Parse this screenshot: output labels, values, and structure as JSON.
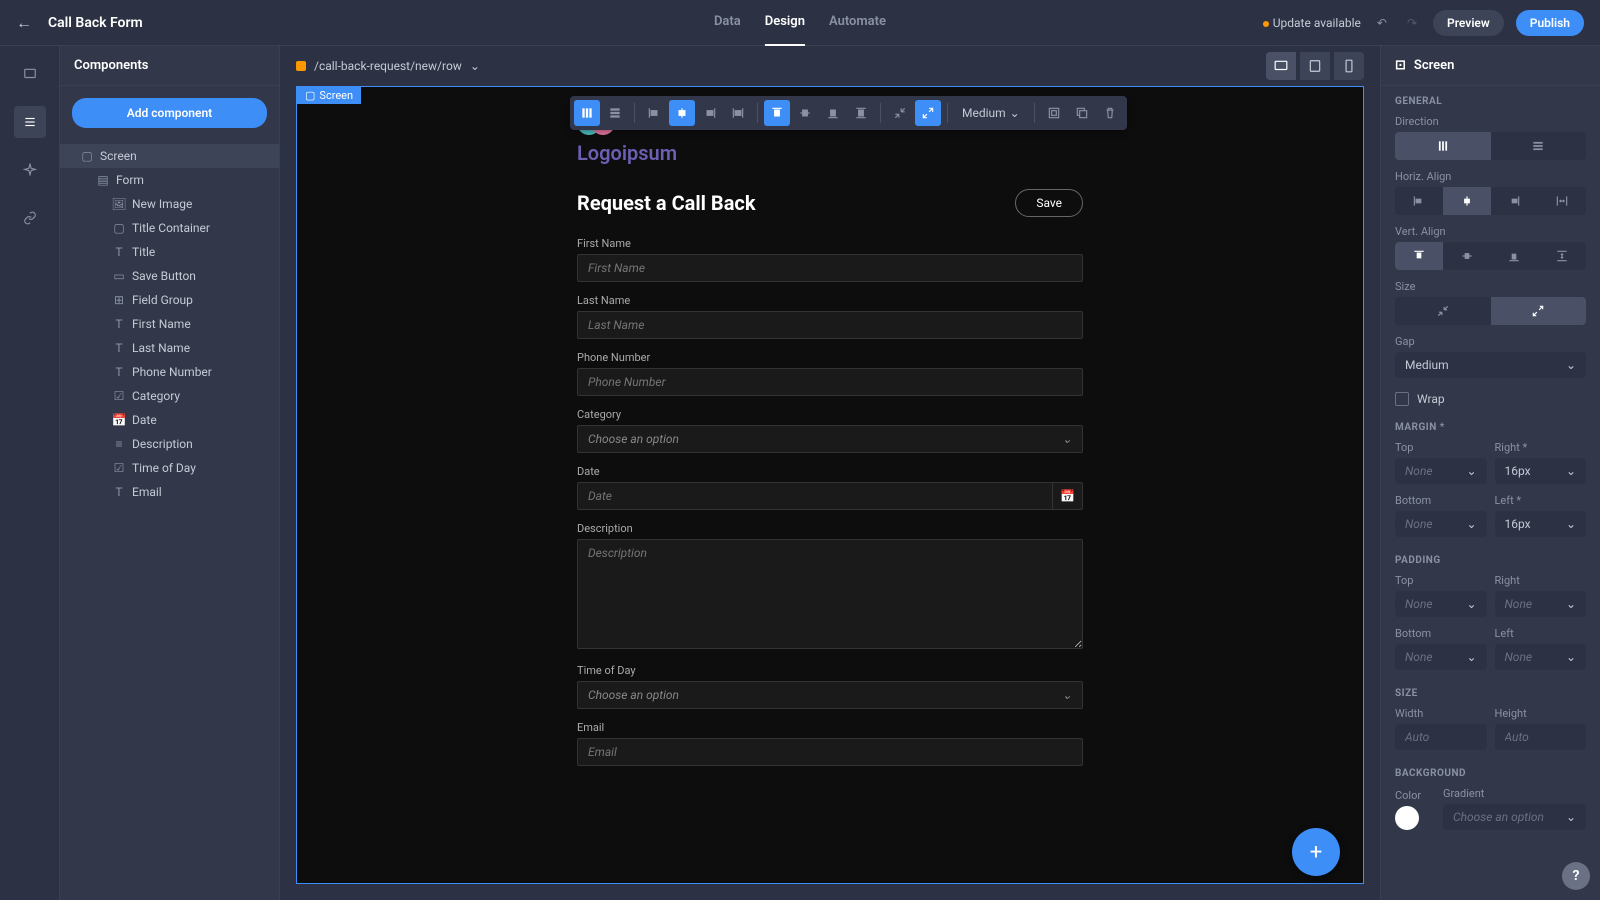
{
  "header": {
    "title": "Call Back Form",
    "tabs": {
      "data": "Data",
      "design": "Design",
      "automate": "Automate"
    },
    "update": "Update available",
    "preview": "Preview",
    "publish": "Publish"
  },
  "leftPanel": {
    "title": "Components",
    "addButton": "Add component",
    "tree": {
      "screen": "Screen",
      "form": "Form",
      "newImage": "New Image",
      "titleContainer": "Title Container",
      "title": "Title",
      "saveButton": "Save Button",
      "fieldGroup": "Field Group",
      "firstName": "First Name",
      "lastName": "Last Name",
      "phoneNumber": "Phone Number",
      "category": "Category",
      "date": "Date",
      "description": "Description",
      "timeOfDay": "Time of Day",
      "email": "Email"
    }
  },
  "breadcrumb": "/call-back-request/new/row",
  "screenTag": "Screen",
  "floatToolbar": {
    "gap": "Medium"
  },
  "form": {
    "logoText": "Logoipsum",
    "title": "Request a Call Back",
    "save": "Save",
    "firstName": {
      "label": "First Name",
      "placeholder": "First Name"
    },
    "lastName": {
      "label": "Last Name",
      "placeholder": "Last Name"
    },
    "phone": {
      "label": "Phone Number",
      "placeholder": "Phone Number"
    },
    "category": {
      "label": "Category",
      "placeholder": "Choose an option"
    },
    "date": {
      "label": "Date",
      "placeholder": "Date"
    },
    "description": {
      "label": "Description",
      "placeholder": "Description"
    },
    "timeOfDay": {
      "label": "Time of Day",
      "placeholder": "Choose an option"
    },
    "email": {
      "label": "Email",
      "placeholder": "Email"
    }
  },
  "rightPanel": {
    "title": "Screen",
    "sections": {
      "general": "GENERAL",
      "direction": "Direction",
      "horizAlign": "Horiz. Align",
      "vertAlign": "Vert. Align",
      "size": "Size",
      "gap": "Gap",
      "gapValue": "Medium",
      "wrap": "Wrap",
      "margin": "MARGIN *",
      "padding": "PADDING",
      "sizeSection": "SIZE",
      "background": "BACKGROUND"
    },
    "margin": {
      "topLabel": "Top",
      "topValue": "None",
      "rightLabel": "Right *",
      "rightValue": "16px",
      "bottomLabel": "Bottom",
      "bottomValue": "None",
      "leftLabel": "Left *",
      "leftValue": "16px"
    },
    "padding": {
      "topLabel": "Top",
      "topValue": "None",
      "rightLabel": "Right",
      "rightValue": "None",
      "bottomLabel": "Bottom",
      "bottomValue": "None",
      "leftLabel": "Left",
      "leftValue": "None"
    },
    "sizeInputs": {
      "widthLabel": "Width",
      "widthPlaceholder": "Auto",
      "heightLabel": "Height",
      "heightPlaceholder": "Auto"
    },
    "bg": {
      "colorLabel": "Color",
      "gradientLabel": "Gradient",
      "gradientPlaceholder": "Choose an option"
    }
  }
}
